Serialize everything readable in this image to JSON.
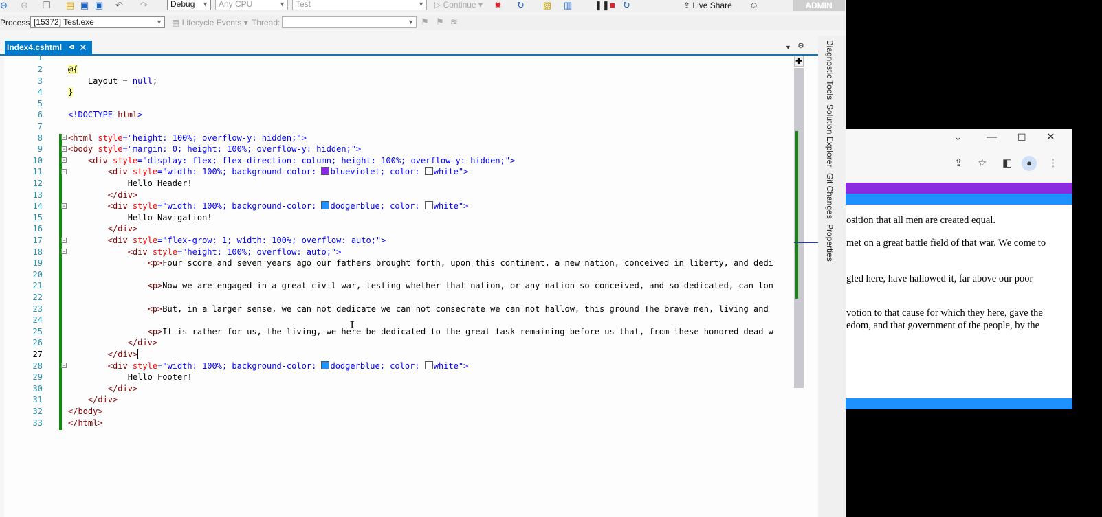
{
  "toolbar": {
    "config": "Debug",
    "platform": "Any CPU",
    "startup_project": "Test",
    "continue_label": "Continue",
    "live_share_label": "Live Share",
    "admin_label": "ADMIN"
  },
  "debug_toolbar": {
    "process_label": "Process:",
    "process_value": "[15372] Test.exe",
    "lifecycle_label": "Lifecycle Events",
    "thread_label": "Thread:",
    "thread_value": ""
  },
  "document_tab": {
    "name": "Index4.cshtml",
    "pin_glyph": "⊲",
    "close_glyph": "✕"
  },
  "side_tabs": [
    "Diagnostic Tools",
    "Solution Explorer",
    "Git Changes",
    "Properties"
  ],
  "editor": {
    "line_numbers": [
      "1",
      "2",
      "3",
      "4",
      "5",
      "6",
      "7",
      "8",
      "9",
      "10",
      "11",
      "12",
      "13",
      "14",
      "15",
      "16",
      "17",
      "18",
      "19",
      "20",
      "21",
      "22",
      "23",
      "24",
      "25",
      "26",
      "27",
      "28",
      "29",
      "30",
      "31",
      "32",
      "33"
    ],
    "lines": {
      "l2": "@{",
      "l3_a": "    Layout = ",
      "l3_b": "null",
      "l3_c": ";",
      "l4": "}",
      "l6_a": "<!DOCTYPE",
      "l6_b": " html",
      "l6_c": ">",
      "l8_tag": "<html",
      "l8_attr": " style",
      "l8_val": "=\"height: 100%; overflow-y: hidden;\"",
      "l8_end": ">",
      "l9_tag": "<body",
      "l9_attr": " style",
      "l9_val": "=\"margin: 0; height: 100%; overflow-y: hidden;\"",
      "l9_end": ">",
      "l10_tag": "    <div",
      "l10_attr": " style",
      "l10_val": "=\"display: flex; flex-direction: column; height: 100%; overflow-y: hidden;\"",
      "l10_end": ">",
      "l11_tag": "        <div",
      "l11_attr": " style",
      "l11_val1": "=\"width: 100%; background-color: ",
      "l11_c1": "blueviolet",
      "l11_val2": "; color: ",
      "l11_c2": "white",
      "l11_end": "\">",
      "l12": "            Hello Header!",
      "l13": "        </div>",
      "l14_tag": "        <div",
      "l14_attr": " style",
      "l14_val1": "=\"width: 100%; background-color: ",
      "l14_c1": "dodgerblue",
      "l14_val2": "; color: ",
      "l14_c2": "white",
      "l14_end": "\">",
      "l15": "            Hello Navigation!",
      "l16": "        </div>",
      "l17_tag": "        <div",
      "l17_attr": " style",
      "l17_val": "=\"flex-grow: 1; width: 100%; overflow: auto;\"",
      "l17_end": ">",
      "l18_tag": "            <div",
      "l18_attr": " style",
      "l18_val": "=\"height: 100%; overflow: auto;\"",
      "l18_end": ">",
      "l19_tag": "                <p>",
      "l19_text": "Four score and seven years ago our fathers brought forth, upon this continent, a new nation, conceived in liberty, and dedi",
      "l21_tag": "                <p>",
      "l21_text": "Now we are engaged in a great civil war, testing whether that nation, or any nation so conceived, and so dedicated, can lon",
      "l23_tag": "                <p>",
      "l23_text": "But, in a larger sense, we can not dedicate we can not consecrate we can not hallow, this ground The brave men, living and ",
      "l25_tag": "                <p>",
      "l25_text": "It is rather for us, the living, we here be dedicated to the great task remaining before us that, from these honored dead w",
      "l26": "            </div>",
      "l27": "        </div>",
      "l28_tag": "        <div",
      "l28_attr": " style",
      "l28_val1": "=\"width: 100%; background-color: ",
      "l28_c1": "dodgerblue",
      "l28_val2": "; color: ",
      "l28_c2": "white",
      "l28_end": "\">",
      "l29": "            Hello Footer!",
      "l30": "        </div>",
      "l31": "    </div>",
      "l32": "</body>",
      "l33": "</html>"
    }
  },
  "browser": {
    "paragraphs": [
      "osition that all men are created equal.",
      " met on a great battle field of that war. We come to",
      "gled here, have hallowed it, far above our poor",
      "votion to that cause for which they here, gave the",
      "edom, and that government of the people, by the"
    ]
  },
  "colors": {
    "accent": "#007acc",
    "change_bar": "#108b10",
    "blueviolet": "#8a2be2",
    "dodgerblue": "#1e90ff",
    "white": "#ffffff"
  }
}
